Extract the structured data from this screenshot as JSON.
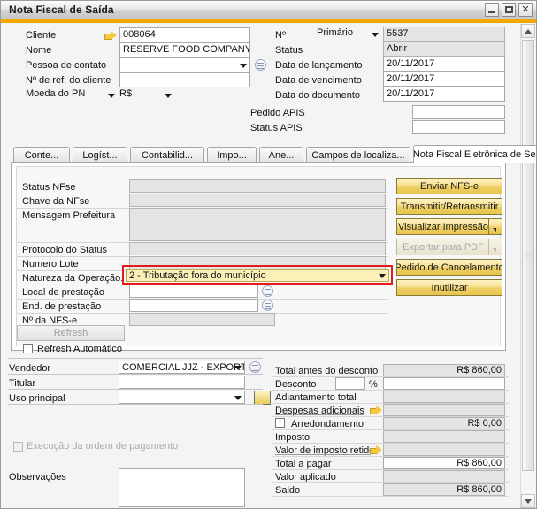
{
  "window": {
    "title": "Nota Fiscal de Saída",
    "minimize_label": "minimize",
    "maximize_label": "maximize",
    "close_label": "✕",
    "accent_color": "#f5a800"
  },
  "header_left": {
    "cliente_label": "Cliente",
    "cliente_value": "008064",
    "nome_label": "Nome",
    "nome_value": "RESERVE FOOD COMPANY",
    "pessoa_contato_label": "Pessoa de contato",
    "pessoa_contato_value": "",
    "ref_cliente_label": "Nº de ref. do cliente",
    "ref_cliente_value": "",
    "moeda_label": "Moeda do PN",
    "moeda_value": "R$"
  },
  "header_right": {
    "numero_label": "Nº",
    "numero_tipo": "Primário",
    "numero_value": "5537",
    "status_label": "Status",
    "status_value": "Abrir",
    "data_lancamento_label": "Data de lançamento",
    "data_lancamento_value": "20/11/2017",
    "data_vencimento_label": "Data de vencimento",
    "data_vencimento_value": "20/11/2017",
    "data_documento_label": "Data do documento",
    "data_documento_value": "20/11/2017",
    "pedido_apis_label": "Pedido APIS",
    "pedido_apis_value": "",
    "status_apis_label": "Status APIS",
    "status_apis_value": ""
  },
  "tabs": [
    {
      "label": "Conte...",
      "active": false
    },
    {
      "label": "Logíst...",
      "active": false
    },
    {
      "label": "Contabilid...",
      "active": false
    },
    {
      "label": "Impo...",
      "active": false
    },
    {
      "label": "Ane...",
      "active": false
    },
    {
      "label": "Campos de localiza...",
      "active": false
    },
    {
      "label": "Nota Fiscal Eletrônica de Serv...",
      "active": true
    }
  ],
  "nfse_form": {
    "status_nfse_label": "Status NFse",
    "status_nfse_value": "",
    "chave_label": "Chave da NFse",
    "chave_value": "",
    "mensagem_label": "Mensagem Prefeitura",
    "mensagem_value": "",
    "protocolo_label": "Protocolo do Status",
    "protocolo_value": "",
    "numero_lote_label": "Numero Lote",
    "numero_lote_value": "",
    "natureza_label": "Natureza da Operação.",
    "natureza_value": "2 - Tributação fora do município",
    "natureza_highlight_color": "#e21b1b",
    "natureza_field_color": "#fbf0b8",
    "local_prestacao_label": "Local de prestação",
    "local_prestacao_value": "",
    "end_prestacao_label": "End. de prestação",
    "end_prestacao_value": "",
    "num_nfse_label": "Nº da NFS-e",
    "num_nfse_value": "",
    "refresh_label": "Refresh",
    "refresh_auto_label": "Refresh Automático",
    "refresh_auto_checked": false
  },
  "nfse_buttons": [
    {
      "label": "Enviar NFS-e",
      "disabled": false,
      "split": false
    },
    {
      "label": "Transmitir/Retransmitir",
      "disabled": false,
      "split": false
    },
    {
      "label": "Visualizar Impressão",
      "disabled": false,
      "split": true
    },
    {
      "label": "Exportar para PDF",
      "disabled": true,
      "split": true
    },
    {
      "label": "Pedido de Cancelamento",
      "disabled": false,
      "split": false
    },
    {
      "label": "Inutilizar",
      "disabled": false,
      "split": false
    }
  ],
  "footer_left": {
    "vendedor_label": "Vendedor",
    "vendedor_value": "COMERCIAL JJZ - EXPORTAÇ",
    "titular_label": "Titular",
    "titular_value": "",
    "uso_principal_label": "Uso principal",
    "uso_principal_value": "",
    "ellipsis_button_label": "...",
    "execucao_label": "Execução da ordem de pagamento",
    "execucao_checked": false,
    "observacoes_label": "Observações",
    "observacoes_value": ""
  },
  "totals": [
    {
      "label": "Total antes do desconto",
      "value": "R$ 860,00",
      "readonly": true,
      "arrow": false,
      "checkbox": false
    },
    {
      "label": "Desconto",
      "value": "",
      "readonly": false,
      "arrow": false,
      "checkbox": false,
      "pct": "%",
      "pct_value": ""
    },
    {
      "label": "Adiantamento total",
      "value": "",
      "readonly": true,
      "arrow": false,
      "checkbox": false
    },
    {
      "label": "Despesas adicionais",
      "value": "",
      "readonly": true,
      "arrow": true,
      "checkbox": false
    },
    {
      "label": "Arredondamento",
      "value": "R$ 0,00",
      "readonly": true,
      "arrow": false,
      "checkbox": true
    },
    {
      "label": "Imposto",
      "value": "",
      "readonly": true,
      "arrow": false,
      "checkbox": false
    },
    {
      "label": "Valor de imposto retido",
      "value": "",
      "readonly": true,
      "arrow": true,
      "checkbox": false
    },
    {
      "label": "Total a pagar",
      "value": "R$ 860,00",
      "readonly": false,
      "arrow": false,
      "checkbox": false
    },
    {
      "label": "Valor aplicado",
      "value": "",
      "readonly": true,
      "arrow": false,
      "checkbox": false
    },
    {
      "label": "Saldo",
      "value": "R$ 860,00",
      "readonly": true,
      "arrow": false,
      "checkbox": false
    }
  ]
}
